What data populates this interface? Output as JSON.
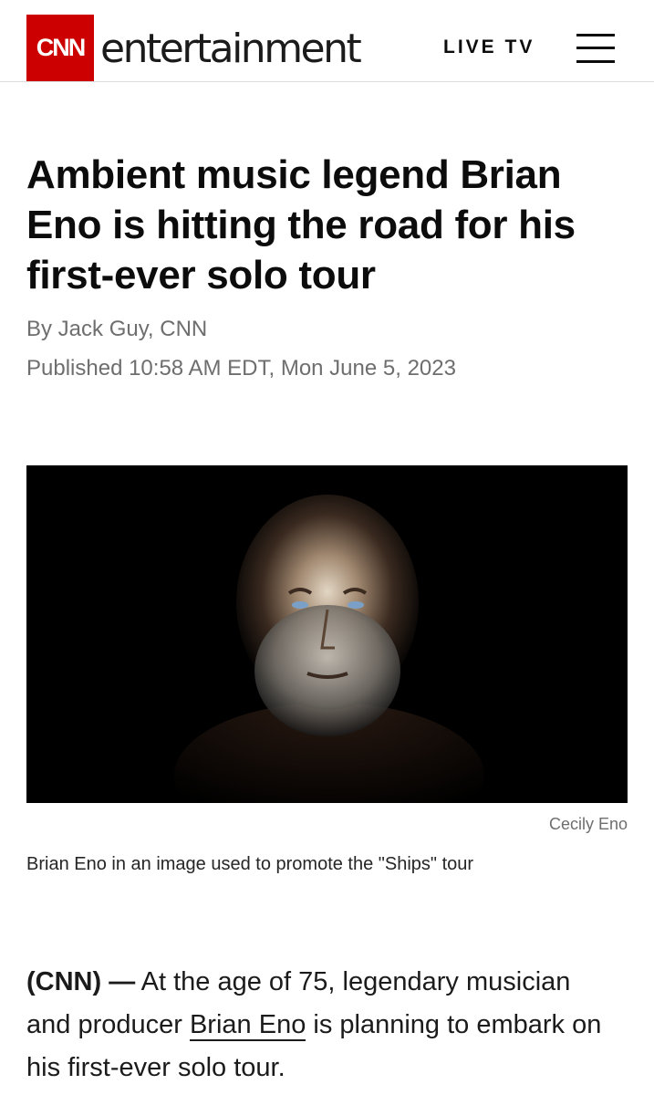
{
  "header": {
    "logo_text": "CNN",
    "section": "entertainment",
    "live_tv": "LIVE TV",
    "menu_icon": "hamburger-menu-icon",
    "brand_color": "#cc0000"
  },
  "article": {
    "headline": "Ambient music legend Brian Eno is hitting the road for his first-ever solo tour",
    "byline": "By Jack Guy, CNN",
    "published": "Published 10:58 AM EDT, Mon June 5, 2023",
    "image_credit": "Cecily Eno",
    "image_caption": "Brian Eno in an image used to promote the \"Ships\" tour",
    "body": {
      "source": "(CNN) —",
      "text_before_link": " At the age of 75, legendary musician and producer ",
      "link_text": "Brian Eno",
      "text_after_link": " is planning to embark on his first-ever solo tour."
    }
  }
}
